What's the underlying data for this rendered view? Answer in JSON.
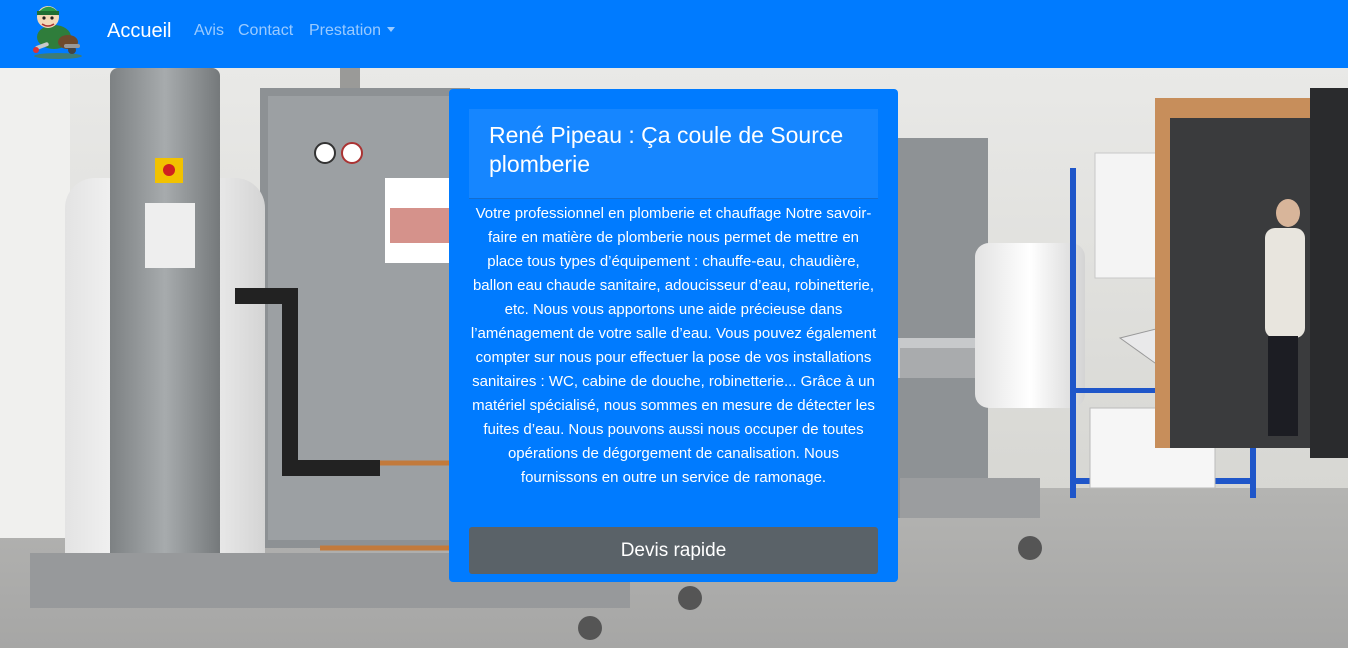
{
  "navbar": {
    "logo_icon": "plumber-mascot-icon",
    "brand_label": "Accueil",
    "links": [
      {
        "label": "Avis"
      },
      {
        "label": "Contact"
      },
      {
        "label": "Prestation",
        "has_dropdown": true
      }
    ],
    "background_color": "#007bff"
  },
  "hero": {
    "background_image": "plumbing-workshop-photo"
  },
  "card": {
    "title": "René Pipeau : Ça coule de Source plomberie",
    "description": "Votre professionnel en plomberie et chauffage Notre savoir-faire en matière de plomberie nous permet de mettre en place tous types d’équipement : chauffe-eau, chaudière, ballon eau chaude sanitaire, adoucisseur d’eau, robinetterie, etc. Nous vous apportons une aide précieuse dans l’aménagement de votre salle d’eau. Vous pouvez également compter sur nous pour effectuer la pose de vos installations sanitaires : WC, cabine de douche, robinetterie... Grâce à un matériel spécialisé, nous sommes en mesure de détecter les fuites d’eau. Nous pouvons aussi nous occuper de toutes opérations de dégorgement de canalisation. Nous fournissons en outre un service de ramonage.",
    "button_label": "Devis rapide",
    "background_color": "#007bff",
    "button_color": "#5a6268"
  }
}
